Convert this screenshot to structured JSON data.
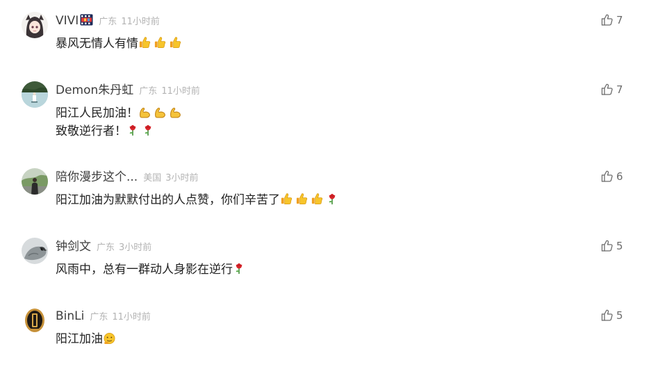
{
  "colors": {
    "username": "#3d3d3d",
    "meta": "#b3b3b3",
    "text": "#222222",
    "like": "#6b6b6b"
  },
  "comments": [
    {
      "user": "VIVI",
      "region": "广东",
      "time": "11小时前",
      "likes": "7",
      "avatar_icon": "anime-girl-avatar",
      "badge_icon": "film-badge-icon",
      "lines": [
        {
          "text": "暴风无情人有情",
          "emojis": [
            "thumbs-up",
            "thumbs-up",
            "thumbs-up"
          ]
        }
      ]
    },
    {
      "user": "Demon朱丹虹",
      "region": "广东",
      "time": "11小时前",
      "likes": "7",
      "avatar_icon": "lake-landscape-avatar",
      "lines": [
        {
          "text": "阳江人民加油！",
          "emojis": [
            "muscle",
            "muscle",
            "muscle"
          ]
        },
        {
          "text": "致敬逆行者！",
          "emojis": [
            "rose",
            "rose"
          ]
        }
      ]
    },
    {
      "user": "陪你漫步这个...",
      "region": "美国",
      "time": "3小时前",
      "likes": "6",
      "avatar_icon": "person-outdoor-avatar",
      "lines": [
        {
          "text": "阳江加油为默默付出的人点赞，你们辛苦了",
          "emojis": [
            "thumbs-up",
            "thumbs-up",
            "thumbs-up",
            "rose"
          ]
        }
      ]
    },
    {
      "user": "钟剑文",
      "region": "广东",
      "time": "3小时前",
      "likes": "5",
      "avatar_icon": "bird-avatar",
      "lines": [
        {
          "text": "风雨中，总有一群动人身影在逆行",
          "emojis": [
            "rose"
          ]
        }
      ]
    },
    {
      "user": "BinLi",
      "region": "广东",
      "time": "11小时前",
      "likes": "5",
      "avatar_icon": "emblem-avatar",
      "lines": [
        {
          "text": "阳江加油",
          "emojis": [
            "salute-face"
          ]
        }
      ]
    }
  ]
}
